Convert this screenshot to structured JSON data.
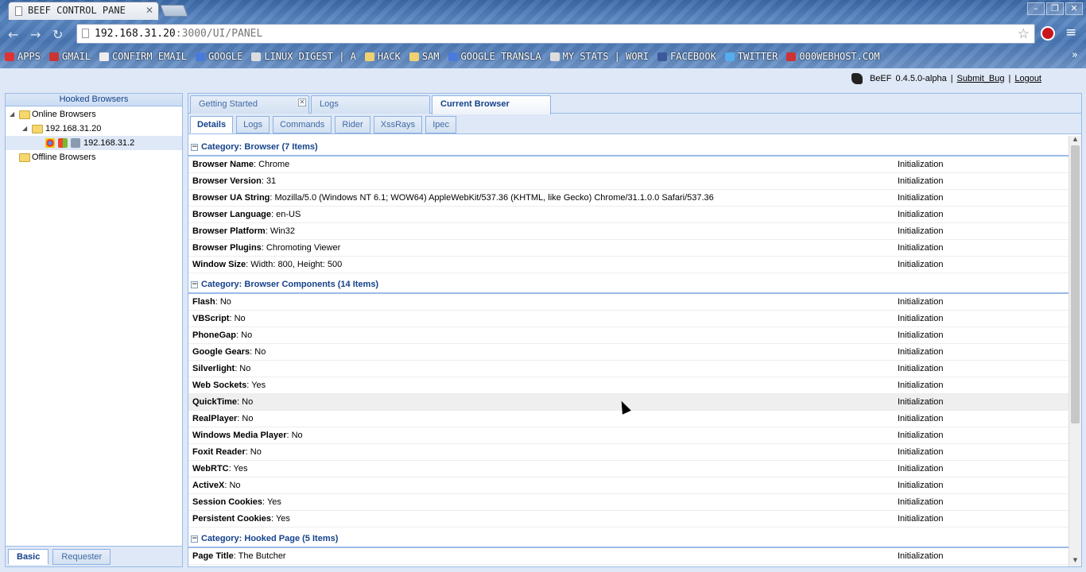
{
  "browser": {
    "tab_title": "BEEF CONTROL PANE",
    "url_host": "192.168.31.20",
    "url_path": ":3000/UI/PANEL",
    "bookmarks": [
      {
        "label": "APPS",
        "icon": "apps-icon",
        "color": "#d33"
      },
      {
        "label": "GMAIL",
        "icon": "gmail-icon",
        "color": "#c33"
      },
      {
        "label": "CONFIRM EMAIL",
        "icon": "page-icon",
        "color": "#eee"
      },
      {
        "label": "GOOGLE",
        "icon": "google-icon",
        "color": "#4a7bdc"
      },
      {
        "label": "LINUX DIGEST | A",
        "icon": "linux-icon",
        "color": "#ddd"
      },
      {
        "label": "HACK",
        "icon": "folder-icon",
        "color": "#f0d070"
      },
      {
        "label": "SAM",
        "icon": "folder-icon",
        "color": "#f0d070"
      },
      {
        "label": "GOOGLE TRANSLA",
        "icon": "translate-icon",
        "color": "#4a7bdc"
      },
      {
        "label": "MY STATS | WORI",
        "icon": "wordpress-icon",
        "color": "#ddd"
      },
      {
        "label": "FACEBOOK",
        "icon": "facebook-icon",
        "color": "#3b5998"
      },
      {
        "label": "TWITTER",
        "icon": "twitter-icon",
        "color": "#55acee"
      },
      {
        "label": "000WEBHOST.COM",
        "icon": "webhost-icon",
        "color": "#c33"
      }
    ]
  },
  "topbar": {
    "product": "BeEF",
    "version": "0.4.5.0-alpha",
    "separator": "|",
    "submit_bug": "Submit_Bug",
    "logout": "Logout"
  },
  "west": {
    "title": "Hooked Browsers",
    "online_label": "Online Browsers",
    "subnet_label": "192.168.31.20",
    "host_label": "192.168.31.2",
    "offline_label": "Offline Browsers",
    "footer_tabs": [
      "Basic",
      "Requester"
    ]
  },
  "main_tabs": [
    "Getting Started",
    "Logs",
    "Current Browser"
  ],
  "sub_tabs": [
    "Details",
    "Logs",
    "Commands",
    "Rider",
    "XssRays",
    "Ipec"
  ],
  "categories": [
    {
      "title": "Category: Browser (7 Items)",
      "rows": [
        {
          "key": "Browser Name",
          "value": ": Chrome",
          "source": "Initialization"
        },
        {
          "key": "Browser Version",
          "value": ": 31",
          "source": "Initialization"
        },
        {
          "key": "Browser UA String",
          "value": ": Mozilla/5.0 (Windows NT 6.1; WOW64) AppleWebKit/537.36 (KHTML, like Gecko) Chrome/31.1.0.0 Safari/537.36",
          "source": "Initialization"
        },
        {
          "key": "Browser Language",
          "value": ": en-US",
          "source": "Initialization"
        },
        {
          "key": "Browser Platform",
          "value": ": Win32",
          "source": "Initialization"
        },
        {
          "key": "Browser Plugins",
          "value": ": Chromoting Viewer",
          "source": "Initialization"
        },
        {
          "key": "Window Size",
          "value": ": Width: 800, Height: 500",
          "source": "Initialization"
        }
      ]
    },
    {
      "title": "Category: Browser Components (14 Items)",
      "rows": [
        {
          "key": "Flash",
          "value": ": No",
          "source": "Initialization"
        },
        {
          "key": "VBScript",
          "value": ": No",
          "source": "Initialization"
        },
        {
          "key": "PhoneGap",
          "value": ": No",
          "source": "Initialization"
        },
        {
          "key": "Google Gears",
          "value": ": No",
          "source": "Initialization"
        },
        {
          "key": "Silverlight",
          "value": ": No",
          "source": "Initialization"
        },
        {
          "key": "Web Sockets",
          "value": ": Yes",
          "source": "Initialization"
        },
        {
          "key": "QuickTime",
          "value": ": No",
          "source": "Initialization"
        },
        {
          "key": "RealPlayer",
          "value": ": No",
          "source": "Initialization"
        },
        {
          "key": "Windows Media Player",
          "value": ": No",
          "source": "Initialization"
        },
        {
          "key": "Foxit Reader",
          "value": ": No",
          "source": "Initialization"
        },
        {
          "key": "WebRTC",
          "value": ": Yes",
          "source": "Initialization"
        },
        {
          "key": "ActiveX",
          "value": ": No",
          "source": "Initialization"
        },
        {
          "key": "Session Cookies",
          "value": ": Yes",
          "source": "Initialization"
        },
        {
          "key": "Persistent Cookies",
          "value": ": Yes",
          "source": "Initialization"
        }
      ]
    },
    {
      "title": "Category: Hooked Page (5 Items)",
      "rows": [
        {
          "key": "Page Title",
          "value": ": The Butcher",
          "source": "Initialization"
        }
      ]
    }
  ]
}
